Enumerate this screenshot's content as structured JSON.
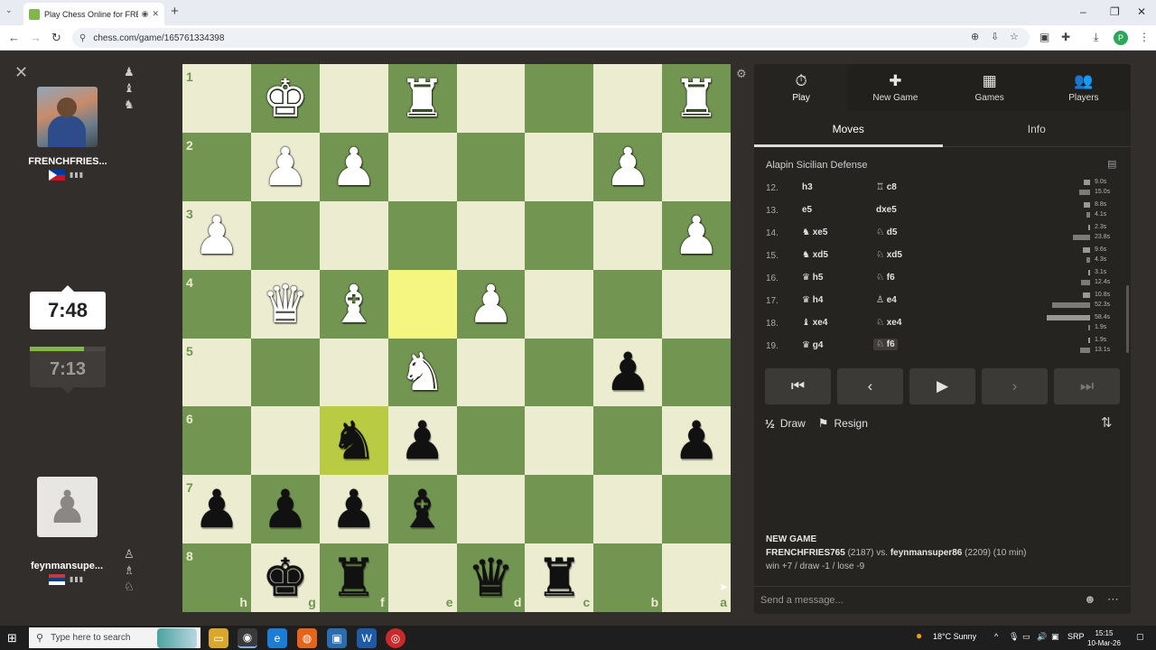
{
  "browser": {
    "tab_title": "Play Chess Online for FREE",
    "url": "chess.com/game/165761334398",
    "profile_initial": "P"
  },
  "players": {
    "top": {
      "name": "FRENCHFRIES...",
      "flag": "ph"
    },
    "bottom": {
      "name": "feynmansupe...",
      "flag": "rs"
    }
  },
  "clocks": {
    "active": "7:48",
    "idle": "7:13",
    "idle_progress": 0.72
  },
  "board": {
    "orientation": "black",
    "files": [
      "h",
      "g",
      "f",
      "e",
      "d",
      "c",
      "b",
      "a"
    ],
    "ranks": [
      "1",
      "2",
      "3",
      "4",
      "5",
      "6",
      "7",
      "8"
    ],
    "rows": [
      [
        "",
        "wK",
        "",
        "wR",
        "",
        "",
        "",
        "wR"
      ],
      [
        "",
        "wP",
        "wP",
        "",
        "",
        "",
        "wP",
        ""
      ],
      [
        "wP",
        "",
        "",
        "",
        "",
        "",
        "",
        "wP"
      ],
      [
        "",
        "wQ",
        "wB",
        "",
        "wP",
        "",
        "",
        ""
      ],
      [
        "",
        "",
        "",
        "wN",
        "",
        "",
        "bP",
        ""
      ],
      [
        "",
        "",
        "bN",
        "bP",
        "",
        "",
        "",
        "bP"
      ],
      [
        "bP",
        "bP",
        "bP",
        "bB",
        "",
        "",
        "",
        ""
      ],
      [
        "",
        "bK",
        "bR",
        "",
        "bQ",
        "bR",
        "",
        ""
      ]
    ],
    "highlights": [
      [
        3,
        3
      ],
      [
        5,
        2
      ]
    ]
  },
  "panel": {
    "tabs": [
      {
        "label": "Play",
        "icon": "stopwatch-icon",
        "glyph": "⏱"
      },
      {
        "label": "New Game",
        "icon": "plus-icon",
        "glyph": "✚"
      },
      {
        "label": "Games",
        "icon": "games-icon",
        "glyph": "▦"
      },
      {
        "label": "Players",
        "icon": "players-icon",
        "glyph": "👥"
      }
    ],
    "subtabs": [
      "Moves",
      "Info"
    ],
    "opening": "Alapin Sicilian Defense",
    "moves": [
      {
        "n": "12.",
        "w": "h3",
        "b": "♖ c8",
        "tw": "9.0s",
        "tb": "15.0s",
        "bw": 0.06,
        "bb": 0.1
      },
      {
        "n": "13.",
        "w": "e5",
        "b": "dxe5",
        "tw": "8.8s",
        "tb": "4.1s",
        "bw": 0.06,
        "bb": 0.03
      },
      {
        "n": "14.",
        "w": "♞ xe5",
        "b": "♘ d5",
        "tw": "2.3s",
        "tb": "23.8s",
        "bw": 0.02,
        "bb": 0.16
      },
      {
        "n": "15.",
        "w": "♞ xd5",
        "b": "♘ xd5",
        "tw": "9.6s",
        "tb": "4.3s",
        "bw": 0.07,
        "bb": 0.03
      },
      {
        "n": "16.",
        "w": "♛ h5",
        "b": "♘ f6",
        "tw": "3.1s",
        "tb": "12.4s",
        "bw": 0.02,
        "bb": 0.08
      },
      {
        "n": "17.",
        "w": "♛ h4",
        "b": "♙ e4",
        "tw": "10.8s",
        "tb": "52.3s",
        "bw": 0.07,
        "bb": 0.35
      },
      {
        "n": "18.",
        "w": "♝ xe4",
        "b": "♘ xe4",
        "tw": "58.4s",
        "tb": "1.9s",
        "bw": 0.4,
        "bb": 0.01
      },
      {
        "n": "19.",
        "w": "♛ g4",
        "b": "♘ f6",
        "tw": "1.9s",
        "tb": "13.1s",
        "bw": 0.01,
        "bb": 0.09
      }
    ],
    "draw_label": "Draw",
    "resign_label": "Resign",
    "new_game": {
      "title": "NEW GAME",
      "white": "FRENCHFRIES765",
      "white_rating": "(2187)",
      "vs": "vs.",
      "black": "feynmansuper86",
      "black_rating": "(2209)",
      "time": "(10 min)",
      "result_line": "win +7 / draw -1 / lose -9"
    },
    "message_placeholder": "Send a message..."
  },
  "taskbar": {
    "search_placeholder": "Type here to search",
    "weather": "18°C  Sunny",
    "lang": "SRP",
    "time": "15:15",
    "date": "10-Mar-26"
  }
}
